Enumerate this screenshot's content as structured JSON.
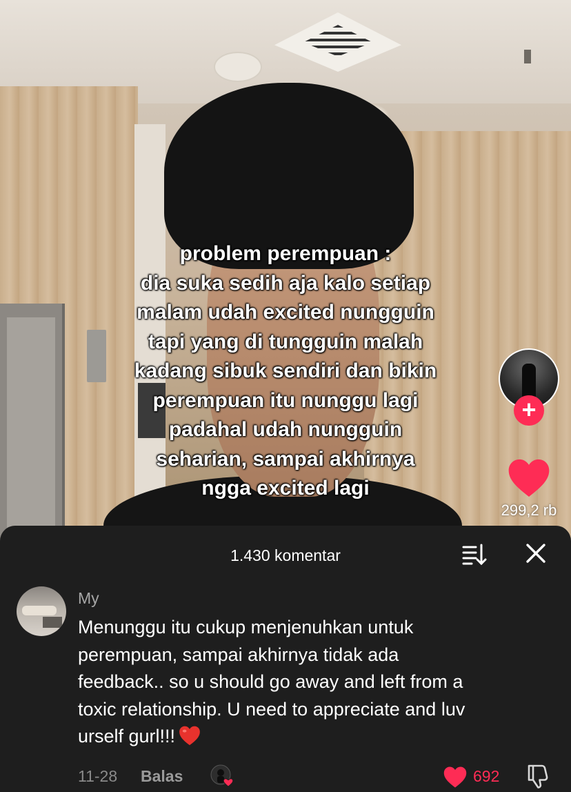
{
  "video": {
    "caption_lines": [
      "problem perempuan :",
      "dia suka sedih aja kalo setiap",
      "malam udah excited nungguin",
      "tapi yang di tungguin malah",
      "kadang sibuk sendiri dan bikin",
      "perempuan itu nunggu lagi",
      "padahal udah nungguin",
      "seharian, sampai akhirnya",
      "ngga excited lagi"
    ],
    "follow_symbol": "+",
    "like_count": "299,2 rb",
    "accent_color": "#fe2c55"
  },
  "comments_sheet": {
    "title": "1.430 komentar",
    "sort_icon": "sort-list-icon",
    "close_icon": "close-icon",
    "comment": {
      "username": "My",
      "text_lines": [
        "Menunggu itu cukup menjenuhkan untuk",
        "perempuan, sampai akhirnya tidak ada",
        "feedback.. so u should go away and left from a",
        "toxic relationship. U need to appreciate and luv",
        "urself gurl!!!"
      ],
      "emoji": "red-heart-emoji",
      "date": "11-28",
      "reply_label": "Balas",
      "likes": "692"
    }
  }
}
